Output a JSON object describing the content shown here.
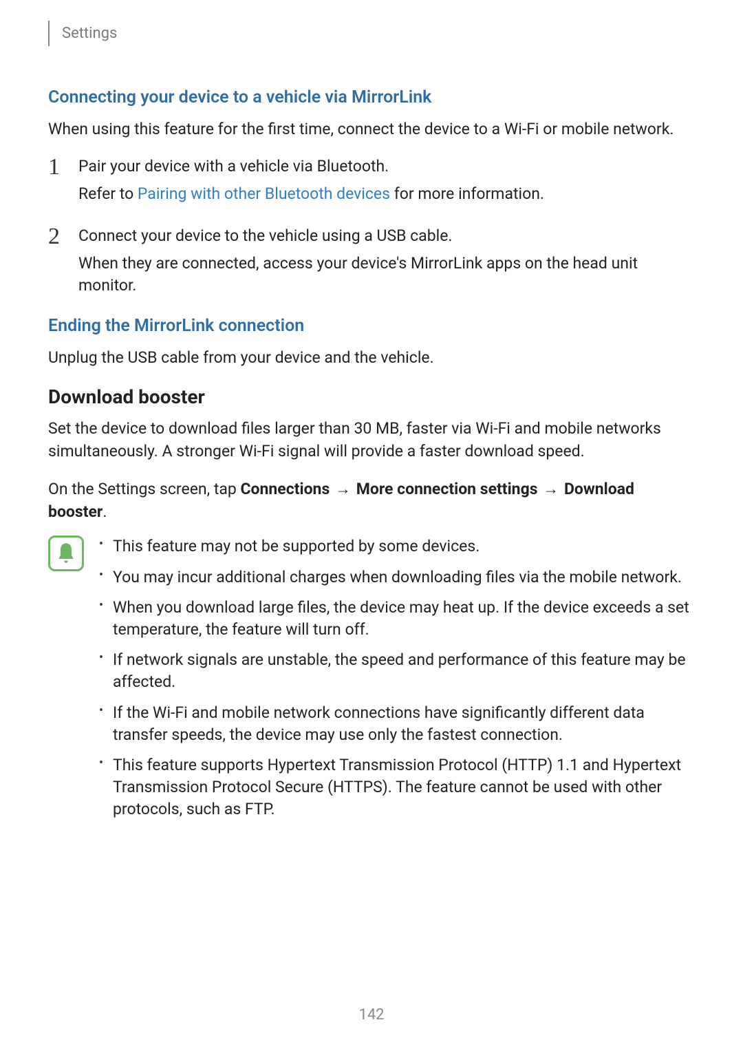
{
  "header": {
    "breadcrumb": "Settings"
  },
  "sections": {
    "connecting_heading": "Connecting your device to a vehicle via MirrorLink",
    "connecting_intro": "When using this feature for the first time, connect the device to a Wi-Fi or mobile network.",
    "step1_num": "1",
    "step1_text": "Pair your device with a vehicle via Bluetooth.",
    "step1_sub_prefix": "Refer to ",
    "step1_sub_link": "Pairing with other Bluetooth devices",
    "step1_sub_suffix": " for more information.",
    "step2_num": "2",
    "step2_text": "Connect your device to the vehicle using a USB cable.",
    "step2_sub": "When they are connected, access your device's MirrorLink apps on the head unit monitor.",
    "ending_heading": "Ending the MirrorLink connection",
    "ending_text": "Unplug the USB cable from your device and the vehicle.",
    "booster_heading": "Download booster",
    "booster_intro": "Set the device to download files larger than 30 MB, faster via Wi-Fi and mobile networks simultaneously. A stronger Wi-Fi signal will provide a faster download speed.",
    "booster_nav_prefix": "On the Settings screen, tap ",
    "booster_nav_1": "Connections",
    "booster_nav_2": "More connection settings",
    "booster_nav_3": "Download booster",
    "booster_nav_period": ".",
    "arrow": "→",
    "notes": {
      "n1": "This feature may not be supported by some devices.",
      "n2": "You may incur additional charges when downloading files via the mobile network.",
      "n3": "When you download large files, the device may heat up. If the device exceeds a set temperature, the feature will turn off.",
      "n4": "If network signals are unstable, the speed and performance of this feature may be affected.",
      "n5": "If the Wi-Fi and mobile network connections have significantly different data transfer speeds, the device may use only the fastest connection.",
      "n6": "This feature supports Hypertext Transmission Protocol (HTTP) 1.1 and Hypertext Transmission Protocol Secure (HTTPS). The feature cannot be used with other protocols, such as FTP."
    }
  },
  "page_number": "142"
}
